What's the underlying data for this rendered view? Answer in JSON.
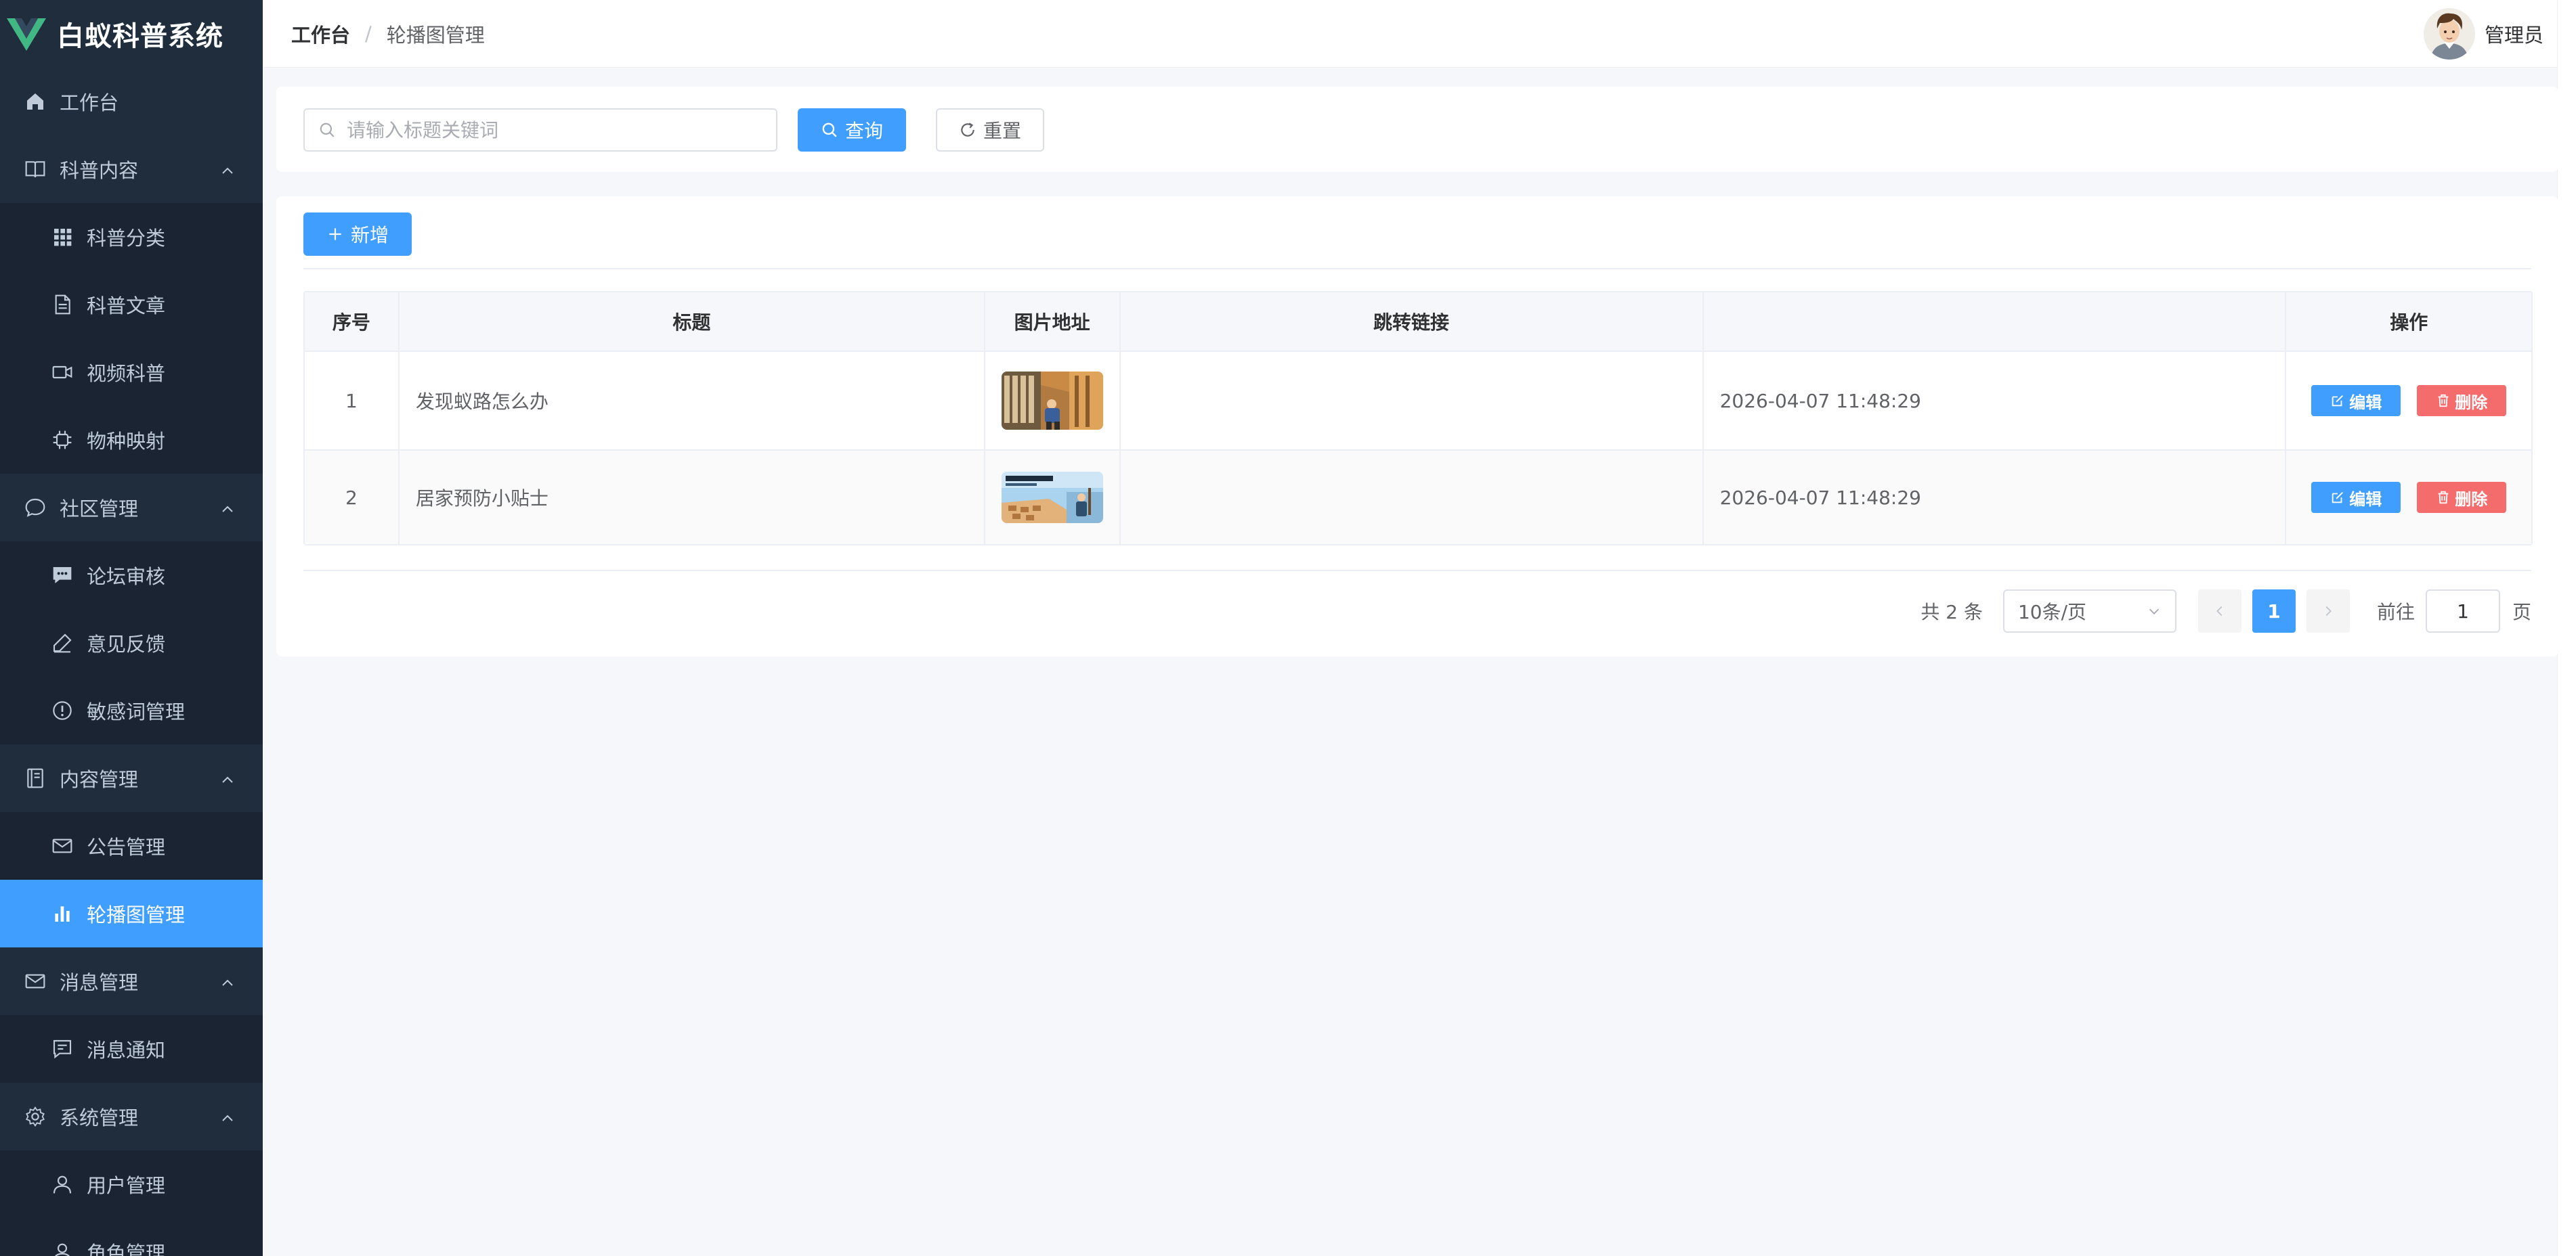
{
  "app": {
    "title": "白蚁科普系统"
  },
  "sidebar": {
    "items": [
      {
        "label": "工作台",
        "icon": "home-icon",
        "level": "top"
      },
      {
        "label": "科普内容",
        "icon": "book-icon",
        "level": "top",
        "expanded": true
      },
      {
        "label": "科普分类",
        "icon": "grid-icon",
        "level": "sub"
      },
      {
        "label": "科普文章",
        "icon": "document-icon",
        "level": "sub"
      },
      {
        "label": "视频科普",
        "icon": "video-camera-icon",
        "level": "sub"
      },
      {
        "label": "物种映射",
        "icon": "chip-icon",
        "level": "sub"
      },
      {
        "label": "社区管理",
        "icon": "chat-bubble-icon",
        "level": "top",
        "expanded": true
      },
      {
        "label": "论坛审核",
        "icon": "message-icon",
        "level": "sub"
      },
      {
        "label": "意见反馈",
        "icon": "pen-icon",
        "level": "sub"
      },
      {
        "label": "敏感词管理",
        "icon": "warning-circle-icon",
        "level": "sub"
      },
      {
        "label": "内容管理",
        "icon": "notebook-icon",
        "level": "top",
        "expanded": true
      },
      {
        "label": "公告管理",
        "icon": "mail-icon",
        "level": "sub"
      },
      {
        "label": "轮播图管理",
        "icon": "bar-chart-icon",
        "level": "sub",
        "active": true
      },
      {
        "label": "消息管理",
        "icon": "mail-icon",
        "level": "top",
        "expanded": true
      },
      {
        "label": "消息通知",
        "icon": "chat-square-icon",
        "level": "sub"
      },
      {
        "label": "系统管理",
        "icon": "gear-icon",
        "level": "top",
        "expanded": true
      },
      {
        "label": "用户管理",
        "icon": "user-icon",
        "level": "sub"
      },
      {
        "label": "角色管理",
        "icon": "user-icon",
        "level": "sub"
      }
    ]
  },
  "header": {
    "breadcrumb": [
      "工作台",
      "轮播图管理"
    ],
    "separator": "/",
    "user_name": "管理员"
  },
  "search": {
    "placeholder": "请输入标题关键词",
    "value": "",
    "query_label": "查询",
    "reset_label": "重置"
  },
  "toolbar": {
    "add_label": "新增"
  },
  "table": {
    "columns": [
      "序号",
      "标题",
      "图片地址",
      "跳转链接",
      "",
      "操作"
    ],
    "rows": [
      {
        "index": "1",
        "title": "发现蚁路怎么办",
        "image": "thumbnail-warehouse-worker",
        "link": "",
        "time": "2026-04-07 11:48:29"
      },
      {
        "index": "2",
        "title": "居家预防小贴士",
        "image": "thumbnail-termite-poster",
        "link": "",
        "time": "2026-04-07 11:48:29"
      }
    ],
    "edit_label": "编辑",
    "delete_label": "删除"
  },
  "pagination": {
    "total_text": "共 2 条",
    "page_size": "10条/页",
    "current_page": "1",
    "goto_label": "前往",
    "goto_value": "1",
    "page_suffix": "页"
  },
  "colors": {
    "sidebar_bg": "#1f2d3d",
    "accent": "#409eff",
    "danger": "#f56c6c"
  }
}
